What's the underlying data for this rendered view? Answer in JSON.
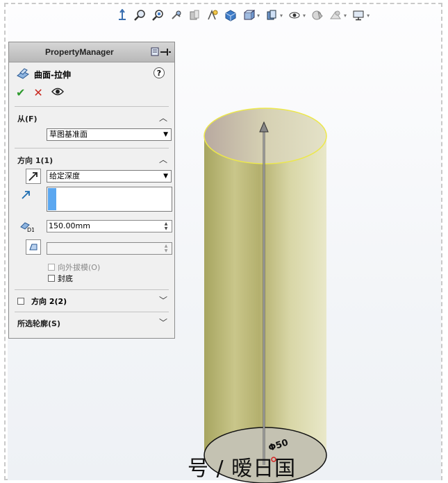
{
  "toolbar": {
    "icons": [
      "view-orientation-icon",
      "zoom-to-fit-icon",
      "zoom-area-icon",
      "previous-view-icon",
      "section-view-icon",
      "dynamic-annotation-icon",
      "view-cube-icon",
      "display-style-icon",
      "hide-show-items-icon",
      "edit-appearance-icon",
      "apply-scene-icon",
      "view-settings-icon",
      "display-monitor-icon"
    ]
  },
  "property_manager": {
    "title": "PropertyManager",
    "feature_name": "曲面-拉伸",
    "help_label": "?",
    "ok_label": "✔",
    "cancel_label": "✕",
    "preview_label": "👁",
    "from_section": {
      "title": "从(F)",
      "start_condition": "草图基准面"
    },
    "direction1": {
      "title": "方向 1(1)",
      "end_condition": "给定深度",
      "depth": "150.00mm",
      "draft_value": "",
      "draft_outward_label": "向外拔模(O)",
      "cap_end_label": "封底"
    },
    "direction2": {
      "title": "方向 2(2)"
    },
    "selected_contours": {
      "title": "所选轮廓(S)"
    }
  },
  "viewport": {
    "dimension_label": "Φ50",
    "watermark": "号 / 暧日国"
  }
}
